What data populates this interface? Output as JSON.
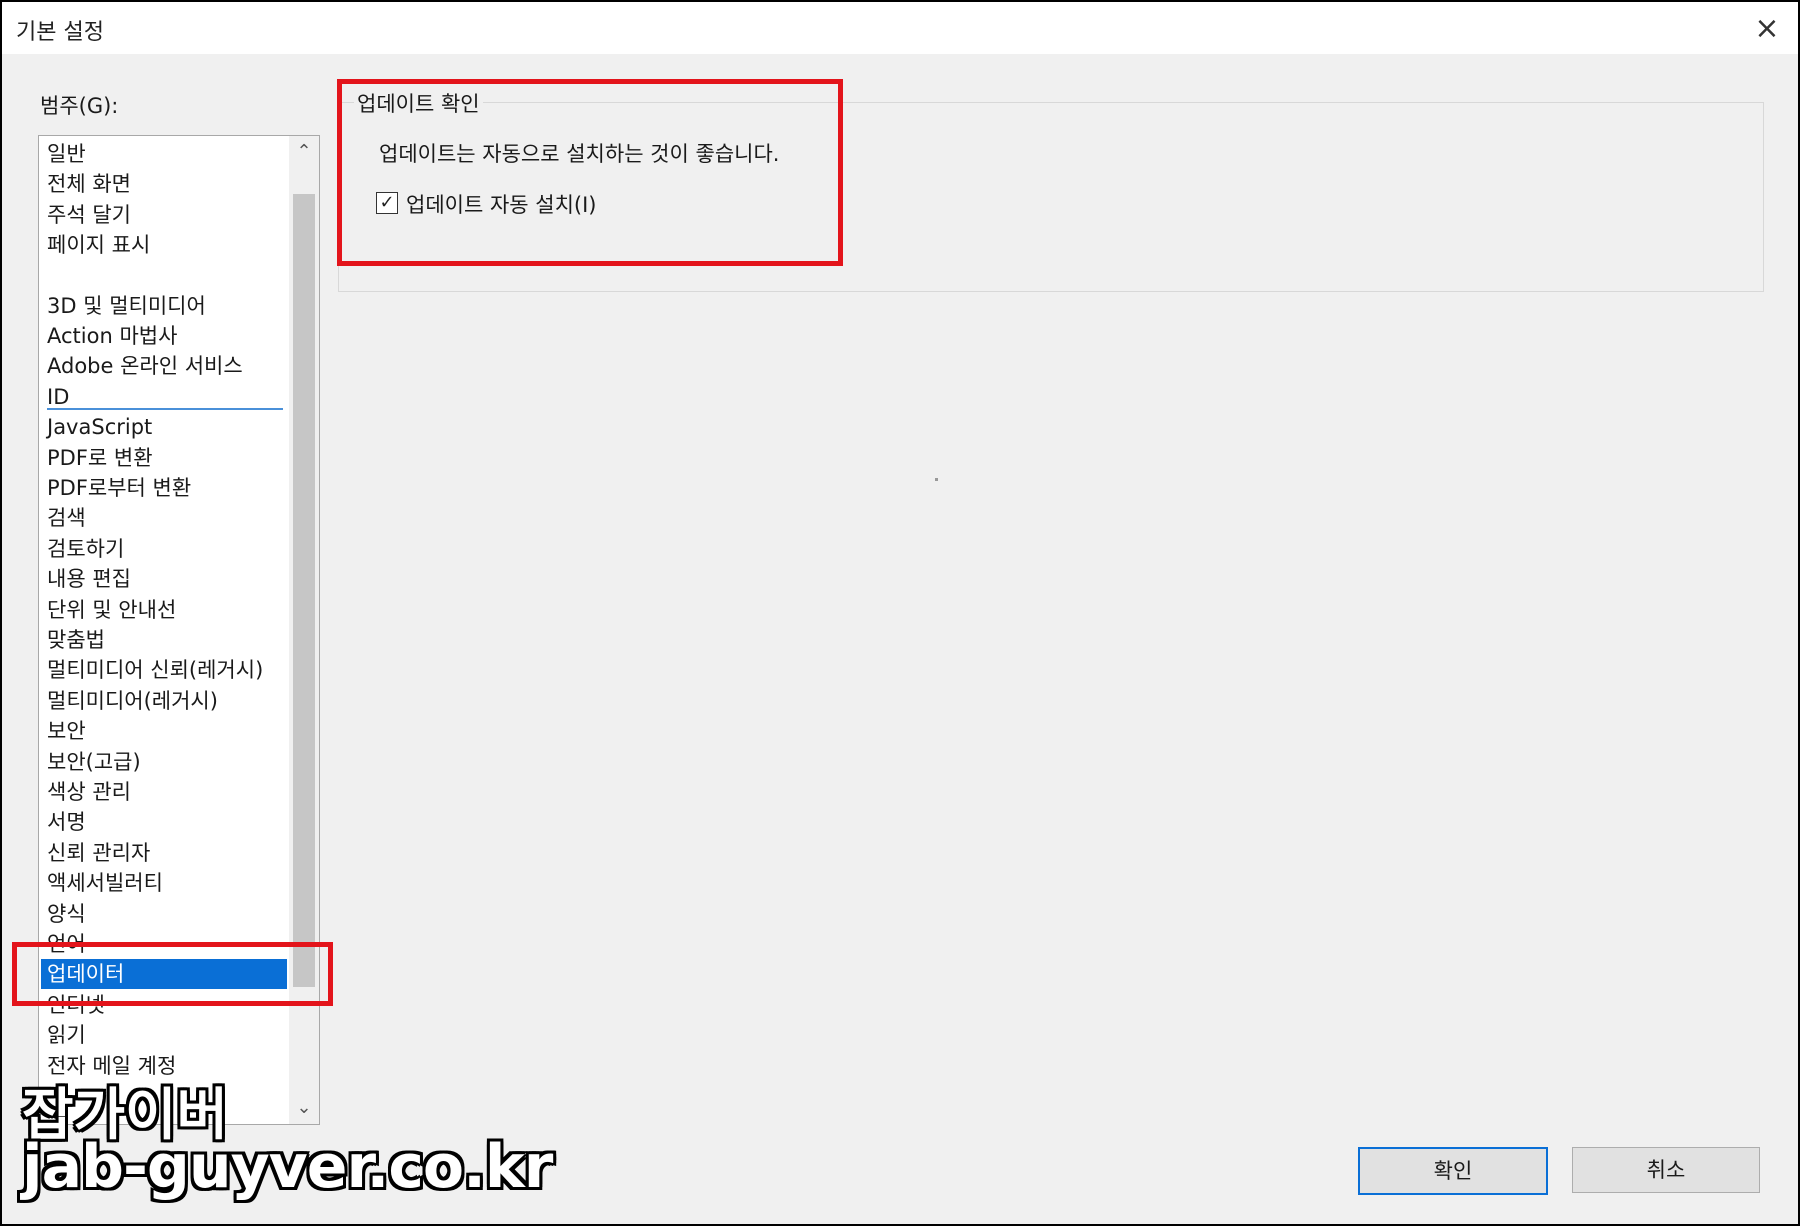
{
  "window": {
    "title": "기본 설정",
    "close_icon": "×"
  },
  "category": {
    "label": "범주(G):",
    "items": [
      "일반",
      "전체 화면",
      "주석 달기",
      "페이지 표시",
      "3D 및 멀티미디어",
      "Action 마법사",
      "Adobe 온라인 서비스",
      "ID",
      "JavaScript",
      "PDF로 변환",
      "PDF로부터 변환",
      "검색",
      "검토하기",
      "내용 편집",
      "단위 및 안내선",
      "맞춤법",
      "멀티미디어 신뢰(레거시)",
      "멀티미디어(레거시)",
      "보안",
      "보안(고급)",
      "색상 관리",
      "서명",
      "신뢰 관리자",
      "액세서빌러티",
      "양식",
      "언어",
      "업데이터",
      "인터넷",
      "읽기",
      "전자 메일 계정"
    ],
    "selected_index": 26,
    "scroll_up_icon": "⌃",
    "scroll_down_icon": "⌄"
  },
  "panel": {
    "group_title": "업데이트 확인",
    "description": "업데이트는 자동으로 설치하는 것이 좋습니다.",
    "checkbox_label": "업데이트 자동 설치(I)",
    "checkbox_checked": true,
    "check_icon": "✓"
  },
  "buttons": {
    "ok": "확인",
    "cancel": "취소"
  },
  "watermark": {
    "line1": "잡가이버",
    "line2": "jab-guyver.co.kr"
  },
  "colors": {
    "highlight": "#e3141b",
    "selection": "#0a6fd6"
  }
}
